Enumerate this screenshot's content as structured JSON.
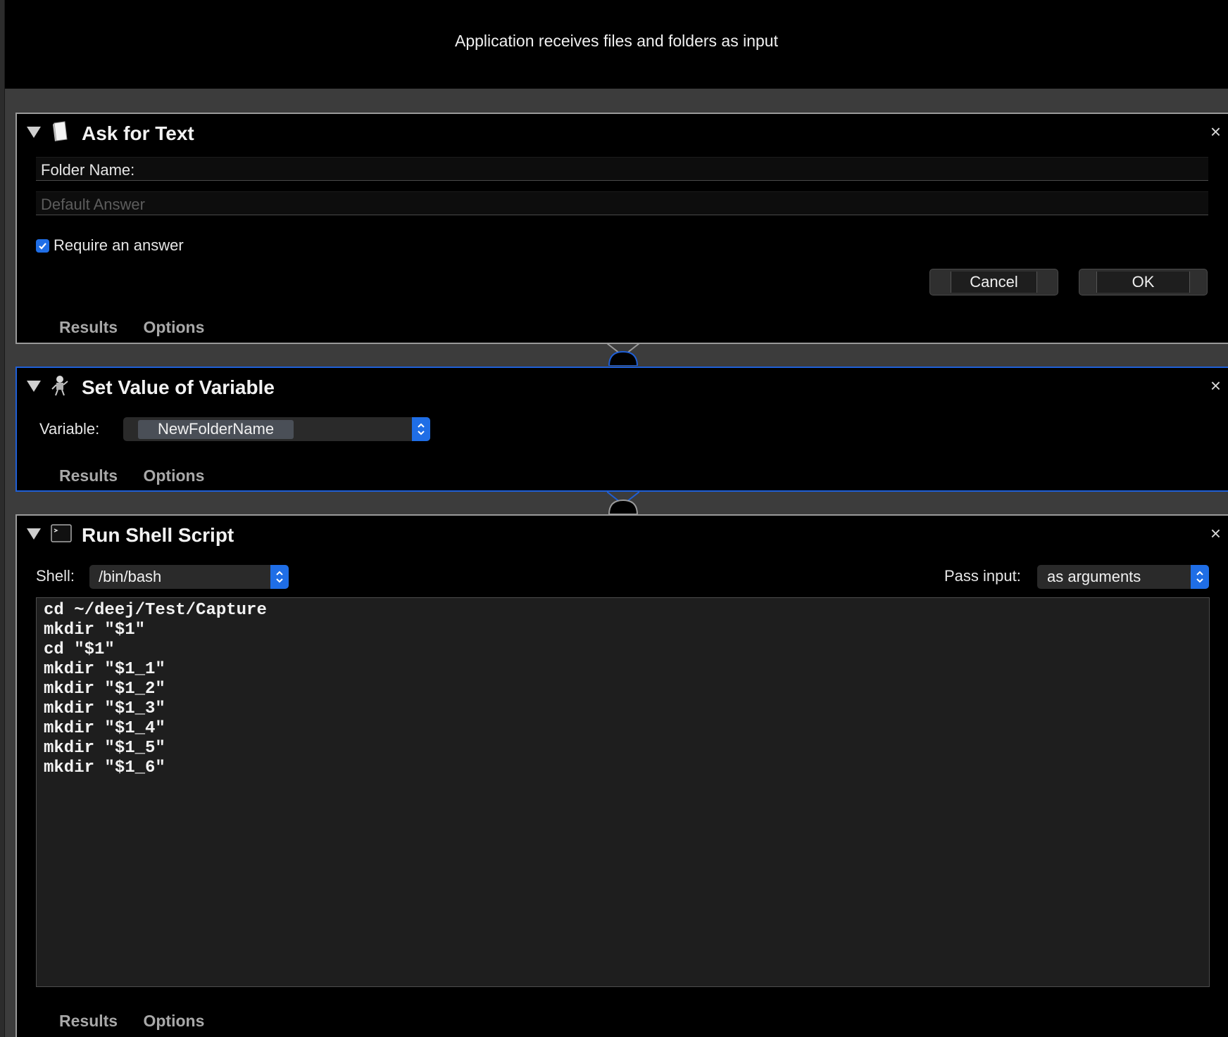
{
  "header": {
    "text": "Application receives files and folders as input"
  },
  "colors": {
    "accent": "#1f6ee6",
    "selected_border": "#1f5fd6",
    "background": "#000000"
  },
  "ask_for_text": {
    "title": "Ask for Text",
    "icon": "document-icon",
    "question": "Folder Name:",
    "default_answer_placeholder": "Default Answer",
    "require_label": "Require an answer",
    "require_checked": true,
    "cancel_label": "Cancel",
    "ok_label": "OK",
    "tab_results": "Results",
    "tab_options": "Options",
    "close": "×"
  },
  "set_variable": {
    "title": "Set Value of Variable",
    "icon": "robot-icon",
    "variable_label": "Variable:",
    "variable_value": "NewFolderName",
    "tab_results": "Results",
    "tab_options": "Options",
    "close": "×"
  },
  "run_shell": {
    "title": "Run Shell Script",
    "icon": "terminal-icon",
    "shell_label": "Shell:",
    "shell_value": "/bin/bash",
    "pass_input_label": "Pass input:",
    "pass_input_value": "as arguments",
    "script": "cd ~/deej/Test/Capture\nmkdir \"$1\"\ncd \"$1\"\nmkdir \"$1_1\"\nmkdir \"$1_2\"\nmkdir \"$1_3\"\nmkdir \"$1_4\"\nmkdir \"$1_5\"\nmkdir \"$1_6\"",
    "tab_results": "Results",
    "tab_options": "Options",
    "close": "×"
  }
}
